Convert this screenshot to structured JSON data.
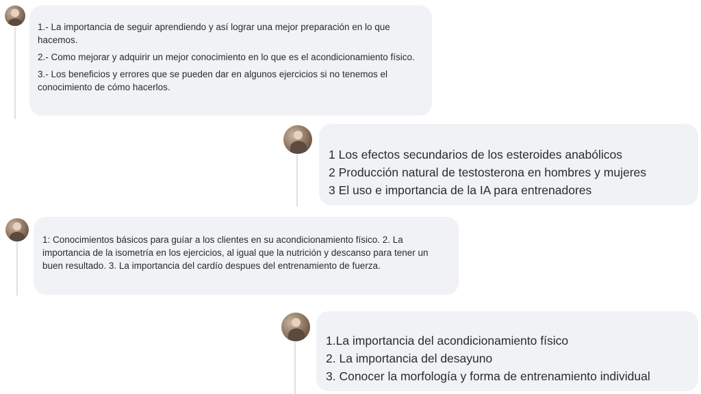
{
  "comments": [
    {
      "avatar_icon": "user-avatar-1",
      "lines": [
        "1.- La importancia de seguir aprendiendo y así lograr una mejor preparación en lo que hacemos.",
        "2.- Como mejorar y adquirir un mejor conocimiento en lo que es el acondicionamiento físico.",
        "3.- Los beneficios y errores que se pueden dar en algunos ejercicios si no tenemos el conocimiento de cómo hacerlos."
      ]
    },
    {
      "avatar_icon": "user-avatar-2",
      "lines": [
        "1 Los efectos secundarios de los esteroides anabólicos",
        "2 Producción natural de testosterona en hombres y mujeres",
        "3 El uso e importancia de la IA para entrenadores"
      ]
    },
    {
      "avatar_icon": "user-avatar-3",
      "lines": [
        "1: Conocimientos básicos para guíar a los clientes en su acondicionamiento físico. 2. La importancia de la isometría en los ejercicios, al igual que la nutrición y descanso para tener un buen resultado. 3. La importancia del cardío despues del entrenamiento de fuerza."
      ]
    },
    {
      "avatar_icon": "user-avatar-4",
      "lines": [
        "1.La importancia del acondicionamiento físico",
        "2. La importancia del desayuno",
        "3. Conocer la morfología y forma de entrenamiento individual"
      ]
    }
  ]
}
